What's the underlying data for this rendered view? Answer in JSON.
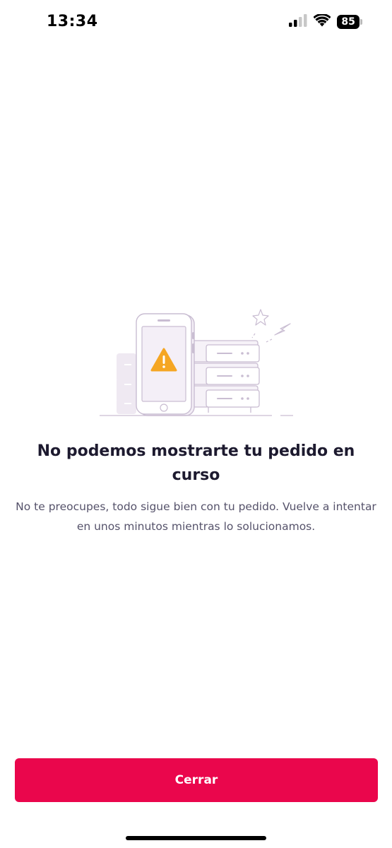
{
  "status_bar": {
    "time": "13:34",
    "battery": "85",
    "icons": [
      "cellular-signal-icon",
      "wifi-icon",
      "battery-icon"
    ]
  },
  "illustration": {
    "name": "phone-server-error-illustration",
    "icons": [
      "phone-icon",
      "warning-icon",
      "server-icon",
      "sparkle-icon",
      "lightning-icon"
    ],
    "accent_color": "#f5a623",
    "line_color": "#c9bdd2"
  },
  "error": {
    "title": "No podemos mostrarte tu pedido en curso",
    "message": "No te preocupes, todo sigue bien con tu pedido. Vuelve a intentar en unos minutos mientras lo solucionamos."
  },
  "actions": {
    "close_label": "Cerrar"
  },
  "colors": {
    "primary": "#ea064c",
    "text_primary": "#1d1a2f",
    "text_secondary": "#55526a",
    "background": "#ffffff"
  }
}
